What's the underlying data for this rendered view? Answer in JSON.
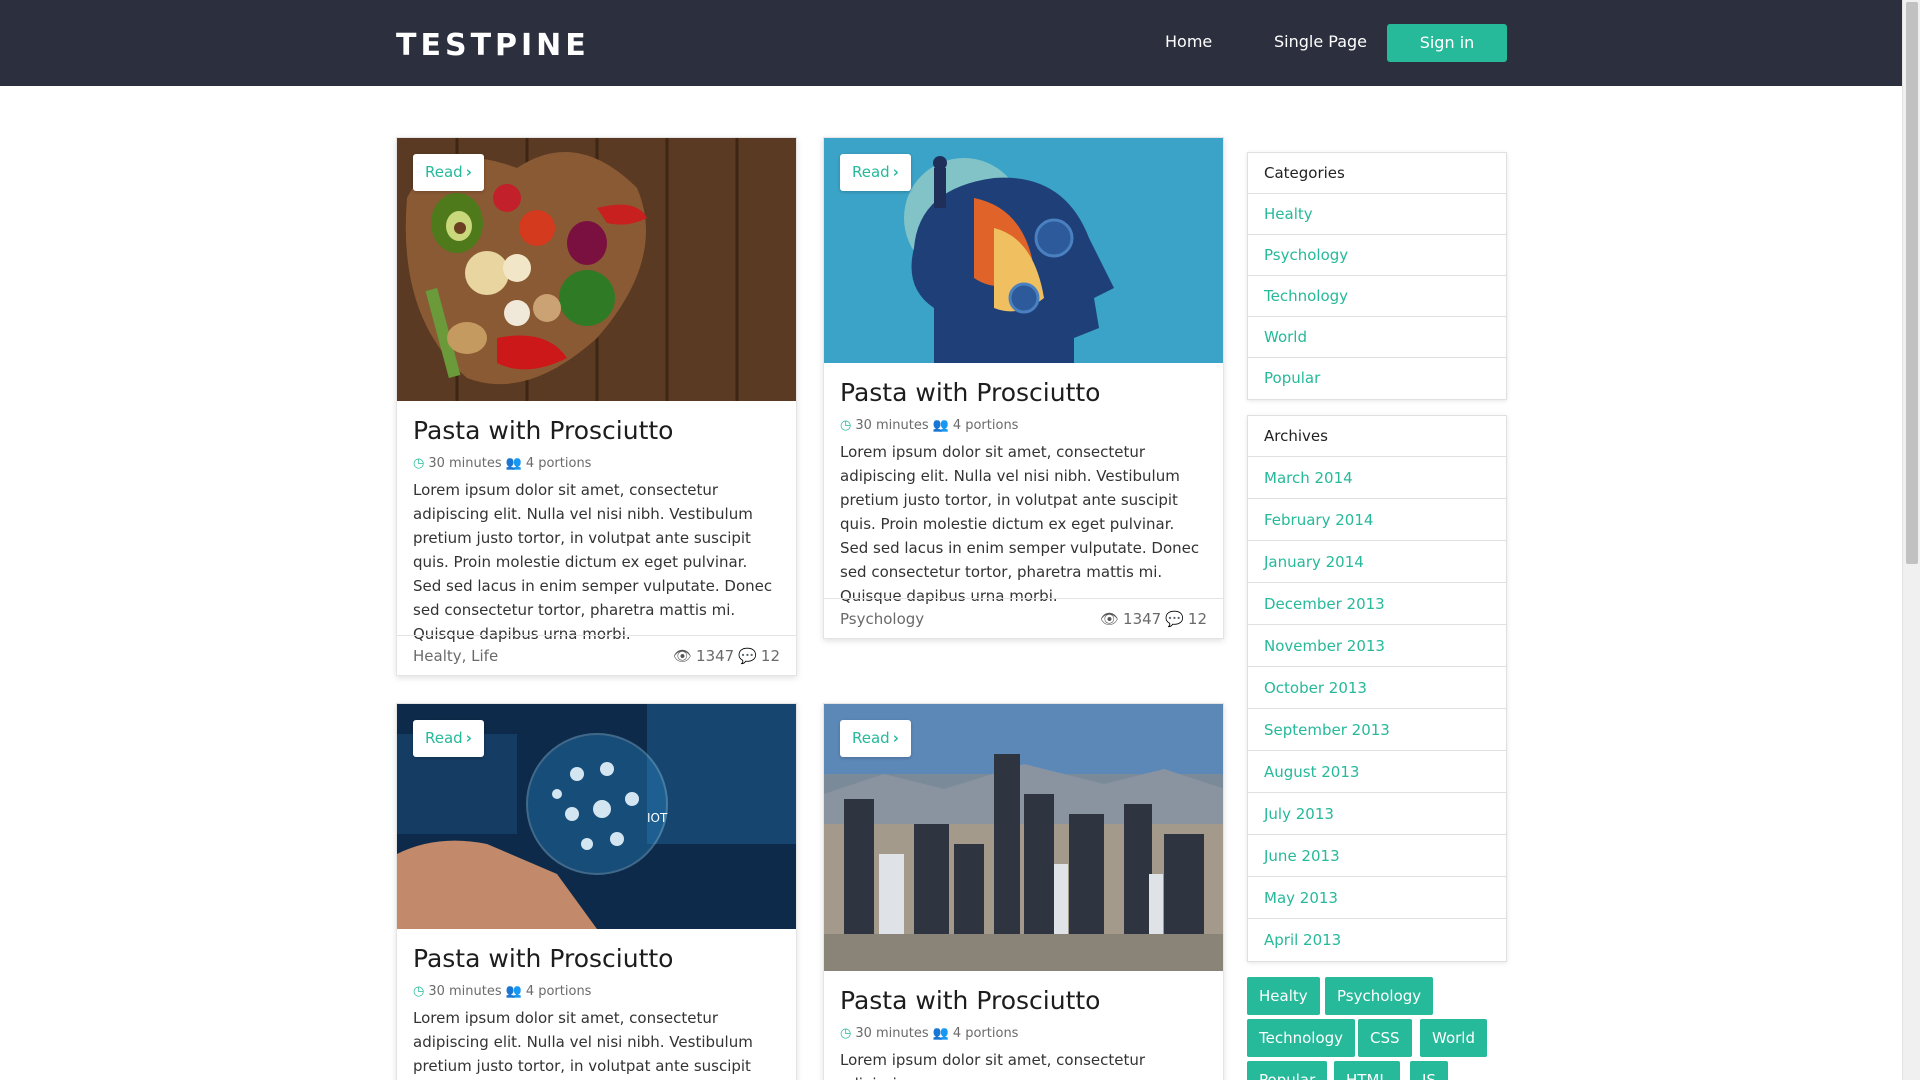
{
  "navbar": {
    "brand": "TESTPINE",
    "links": [
      {
        "label": "Home"
      },
      {
        "label": "Single Page"
      }
    ],
    "signin_label": "Sign in"
  },
  "cards": [
    {
      "read_label": "Read",
      "title": "Pasta with Prosciutto",
      "time": "30 minutes",
      "portions": "4 portions",
      "description": "Lorem ipsum dolor sit amet, consectetur adipiscing elit. Nulla vel nisi nibh. Vestibulum pretium justo tortor, in volutpat ante suscipit quis. Proin molestie dictum ex eget pulvinar. Sed sed lacus in enim semper vulputate. Donec sed consectetur tortor, pharetra mattis mi. Quisque dapibus urna morbi.",
      "categories": "Healty, Life",
      "views": "1347",
      "comments": "12",
      "image": "vegetables-heart-bowl"
    },
    {
      "read_label": "Read",
      "title": "Pasta with Prosciutto",
      "time": "30 minutes",
      "portions": "4 portions",
      "description": "Lorem ipsum dolor sit amet, consectetur adipiscing elit. Nulla vel nisi nibh. Vestibulum pretium justo tortor, in volutpat ante suscipit quis. Proin molestie dictum ex eget pulvinar. Sed sed lacus in enim semper vulputate. Donec sed consectetur tortor, pharetra mattis mi. Quisque dapibus urna morbi.",
      "categories": "Psychology",
      "views": "1347",
      "comments": "12",
      "image": "head-mind-illustration"
    },
    {
      "read_label": "Read",
      "title": "Pasta with Prosciutto",
      "time": "30 minutes",
      "portions": "4 portions",
      "description": "Lorem ipsum dolor sit amet, consectetur adipiscing elit. Nulla vel nisi nibh. Vestibulum pretium justo tortor, in volutpat ante suscipit quis. Proin molestie",
      "image": "hand-iot-globe"
    },
    {
      "read_label": "Read",
      "title": "Pasta with Prosciutto",
      "time": "30 minutes",
      "portions": "4 portions",
      "description": "Lorem ipsum dolor sit amet, consectetur adipiscing",
      "image": "city-skyline"
    }
  ],
  "sidebar": {
    "categories": {
      "title": "Categories",
      "items": [
        "Healty",
        "Psychology",
        "Technology",
        "World",
        "Popular"
      ]
    },
    "archives": {
      "title": "Archives",
      "items": [
        "March 2014",
        "February 2014",
        "January 2014",
        "December 2013",
        "November 2013",
        "October 2013",
        "September 2013",
        "August 2013",
        "July 2013",
        "June 2013",
        "May 2013",
        "April 2013"
      ]
    },
    "tags": [
      "Healty",
      "Psychology",
      "Technology",
      "CSS",
      "World",
      "Popular",
      "HTML",
      "JS"
    ]
  },
  "colors": {
    "accent": "#26b99a",
    "navbar_bg": "#2c2f3d"
  }
}
